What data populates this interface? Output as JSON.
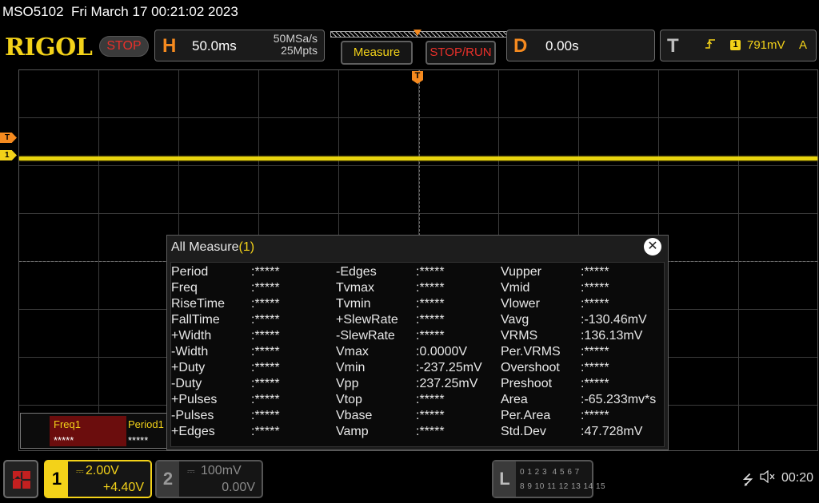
{
  "titlebar": {
    "text": "MSO5102  Fri March 17 00:21:02 2023"
  },
  "top": {
    "logo": "RIGOL",
    "status": "STOP",
    "horizontal": {
      "letter": "H",
      "timebase": "50.0ms",
      "sample_rate": "50MSa/s",
      "memory_depth": "25Mpts"
    },
    "measure_button": "Measure",
    "stop_run_button": "STOP/RUN",
    "delay": {
      "letter": "D",
      "value": "0.00s"
    },
    "trigger": {
      "letter": "T",
      "edge_icon": "rising-edge-icon",
      "edge_symbol": "⌐",
      "source": "1",
      "level": "791mV",
      "coupling": "A"
    }
  },
  "screen": {
    "trigger_marker": "T",
    "left_markers": {
      "trigger_level": "T",
      "channel1": "1"
    },
    "trace_color": "#e8d40e"
  },
  "measure_strip": {
    "items": [
      {
        "label": "Freq1",
        "value": "*****"
      },
      {
        "label": "Period1",
        "value": "*****"
      }
    ]
  },
  "panel": {
    "title": "All Measure",
    "count": "(1)",
    "close_icon": "✕",
    "columns": [
      {
        "rows": [
          {
            "label": "Period",
            "value": ":*****"
          },
          {
            "label": "Freq",
            "value": ":*****"
          },
          {
            "label": "RiseTime",
            "value": ":*****"
          },
          {
            "label": "FallTime",
            "value": ":*****"
          },
          {
            "label": "+Width",
            "value": ":*****"
          },
          {
            "label": "-Width",
            "value": ":*****"
          },
          {
            "label": "+Duty",
            "value": ":*****"
          },
          {
            "label": "-Duty",
            "value": ":*****"
          },
          {
            "label": "+Pulses",
            "value": ":*****"
          },
          {
            "label": "-Pulses",
            "value": ":*****"
          },
          {
            "label": "+Edges",
            "value": ":*****"
          }
        ]
      },
      {
        "rows": [
          {
            "label": "-Edges",
            "value": ":*****"
          },
          {
            "label": "Tvmax",
            "value": ":*****"
          },
          {
            "label": "Tvmin",
            "value": ":*****"
          },
          {
            "label": "+SlewRate",
            "value": ":*****"
          },
          {
            "label": "-SlewRate",
            "value": ":*****"
          },
          {
            "label": "Vmax",
            "value": ":0.0000V"
          },
          {
            "label": "Vmin",
            "value": ":-237.25mV"
          },
          {
            "label": "Vpp",
            "value": ":237.25mV"
          },
          {
            "label": "Vtop",
            "value": ":*****"
          },
          {
            "label": "Vbase",
            "value": ":*****"
          },
          {
            "label": "Vamp",
            "value": ":*****"
          }
        ]
      },
      {
        "rows": [
          {
            "label": "Vupper",
            "value": ":*****"
          },
          {
            "label": "Vmid",
            "value": ":*****"
          },
          {
            "label": "Vlower",
            "value": ":*****"
          },
          {
            "label": "Vavg",
            "value": ":-130.46mV"
          },
          {
            "label": "VRMS",
            "value": ":136.13mV"
          },
          {
            "label": "Per.VRMS",
            "value": ":*****"
          },
          {
            "label": "Overshoot",
            "value": ":*****"
          },
          {
            "label": "Preshoot",
            "value": ":*****"
          },
          {
            "label": "Area",
            "value": ":-65.233mv*s"
          },
          {
            "label": "Per.Area",
            "value": ":*****"
          },
          {
            "label": "Std.Dev",
            "value": ":47.728mV"
          }
        ]
      }
    ]
  },
  "bottom": {
    "home_icon": "grid-menu-icon",
    "ch1": {
      "num": "1",
      "coupling_symbol": "⎓",
      "scale": "2.00V",
      "offset": "+4.40V"
    },
    "ch2": {
      "num": "2",
      "coupling_symbol": "⎓",
      "scale": "100mV",
      "offset": "0.00V"
    },
    "logic": {
      "letter": "L",
      "row1": "0 1 2 3  4 5 6 7",
      "row2": "8 9 10 11 12 13 14 15"
    },
    "usb_icon": "⭍",
    "speaker_icon": "🔈",
    "clock": "00:20"
  }
}
